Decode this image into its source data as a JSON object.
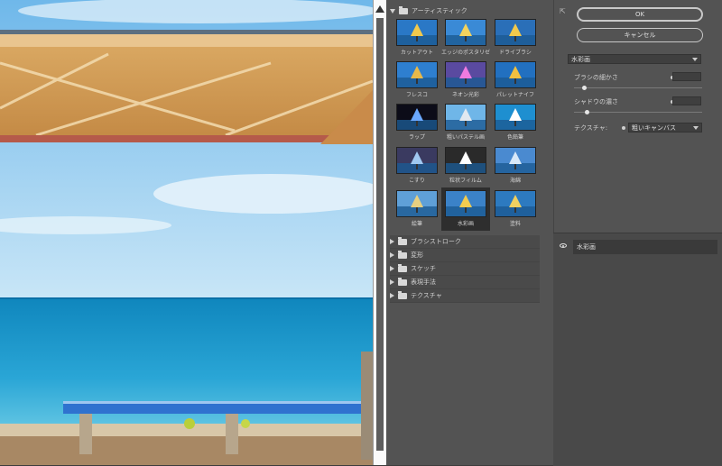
{
  "filter_gallery": {
    "root_folder": {
      "label": "アーティスティック"
    },
    "filters": [
      {
        "label": "カットアウト",
        "icon": "cutout-thumb"
      },
      {
        "label": "エッジのポスタリゼーション",
        "icon": "poster-edges-thumb"
      },
      {
        "label": "ドライブラシ",
        "icon": "dry-brush-thumb"
      },
      {
        "label": "フレスコ",
        "icon": "fresco-thumb"
      },
      {
        "label": "ネオン光彩",
        "icon": "neon-glow-thumb"
      },
      {
        "label": "パレットナイフ",
        "icon": "palette-knife-thumb"
      },
      {
        "label": "ラップ",
        "icon": "plastic-wrap-thumb"
      },
      {
        "label": "粗いパステル画",
        "icon": "rough-pastels-thumb"
      },
      {
        "label": "色鉛筆",
        "icon": "colored-pencil-thumb"
      },
      {
        "label": "こすり",
        "icon": "smudge-stick-thumb"
      },
      {
        "label": "粒状フィルム",
        "icon": "film-grain-thumb"
      },
      {
        "label": "海綿",
        "icon": "sponge-thumb"
      },
      {
        "label": "絵筆",
        "icon": "paint-daubs-thumb"
      },
      {
        "label": "水彩画",
        "icon": "watercolor-thumb"
      },
      {
        "label": "塗料",
        "icon": "underpainting-thumb"
      }
    ],
    "selected_index": 13,
    "folders": [
      {
        "label": "ブラシストローク"
      },
      {
        "label": "変形"
      },
      {
        "label": "スケッチ"
      },
      {
        "label": "表現手法"
      },
      {
        "label": "テクスチャ"
      }
    ]
  },
  "settings": {
    "ok_label": "OK",
    "cancel_label": "キャンセル",
    "filter_select": "水彩画",
    "params": [
      {
        "label": "ブラシの細かさ",
        "value": 0.08
      },
      {
        "label": "シャドウの濃さ",
        "value": 0.1
      },
      {
        "label": "テクスチャ",
        "value": 1
      }
    ],
    "texture_label": "テクスチャ",
    "texture_select": "粗いキャンバス"
  },
  "layers": {
    "items": [
      {
        "label": "水彩画",
        "visible": true
      }
    ]
  },
  "colors": {
    "panel": "#535353",
    "preview_sky": "#8fc9ef",
    "preview_sea": "#1d98cc",
    "bench_blue": "#2f72cf"
  }
}
